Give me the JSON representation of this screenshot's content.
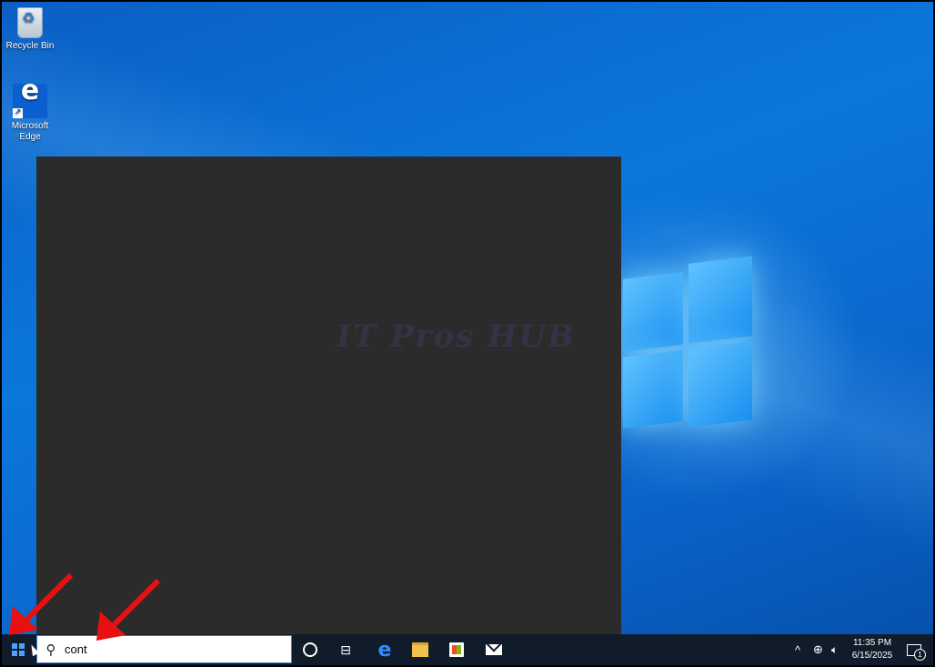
{
  "desktop": {
    "icons": [
      {
        "label": "Recycle Bin",
        "icon": "recycle-bin-icon"
      },
      {
        "label": "Microsoft\nEdge",
        "label_line1": "Microsoft",
        "label_line2": "Edge",
        "icon": "edge-icon"
      }
    ],
    "watermark": "IT Pros HUB"
  },
  "taskbar": {
    "search": {
      "value": "cont",
      "icon": "search-icon"
    },
    "pinned": [
      "cortana-icon",
      "task-view-icon",
      "edge-icon",
      "file-explorer-icon",
      "store-icon",
      "mail-icon"
    ],
    "tray": {
      "chevron": "^",
      "time": "11:35 PM",
      "date": "6/15/2025",
      "notification_count": "1"
    }
  },
  "colors": {
    "accent": "#0078d7",
    "taskbar": "#101c2a",
    "start_menu": "#2b2b2b",
    "annotation_arrow": "#e81010"
  }
}
